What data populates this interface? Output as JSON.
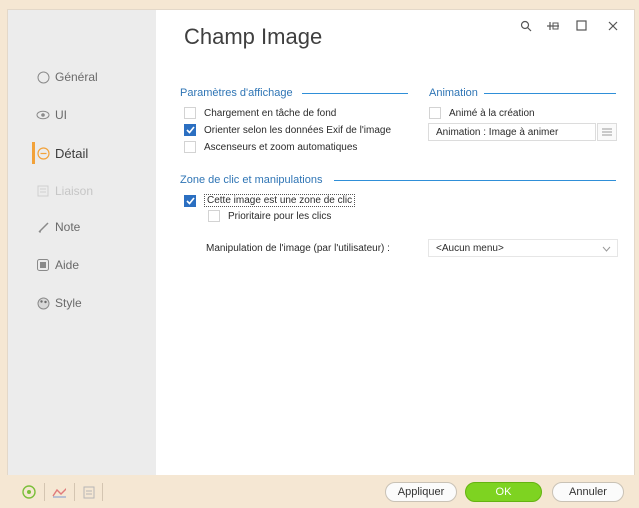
{
  "window": {
    "title": "Champ Image",
    "controls": {
      "search": "⌕",
      "pin": "⊣",
      "maximize": "☐",
      "close": "×"
    }
  },
  "sidebar": {
    "items": [
      {
        "label": "Général",
        "icon": "circle-icon",
        "state": "normal"
      },
      {
        "label": "UI",
        "icon": "eye-icon",
        "state": "normal"
      },
      {
        "label": "Détail",
        "icon": "detail-icon",
        "state": "active"
      },
      {
        "label": "Liaison",
        "icon": "link-icon",
        "state": "disabled"
      },
      {
        "label": "Note",
        "icon": "pencil-icon",
        "state": "normal"
      },
      {
        "label": "Aide",
        "icon": "help-icon",
        "state": "normal"
      },
      {
        "label": "Style",
        "icon": "palette-icon",
        "state": "normal"
      }
    ]
  },
  "display_params": {
    "title": "Paramètres d'affichage",
    "options": [
      {
        "label": "Chargement en tâche de fond",
        "checked": false
      },
      {
        "label": "Orienter selon les données Exif de l'image",
        "checked": true
      },
      {
        "label": "Ascenseurs et zoom automatiques",
        "checked": false
      }
    ]
  },
  "animation": {
    "title": "Animation",
    "option": {
      "label": "Animé à la création",
      "checked": false
    },
    "combo_value": "Animation : Image à animer"
  },
  "click_zone": {
    "title": "Zone de clic et manipulations",
    "options": [
      {
        "label": "Cette image est une zone de clic",
        "checked": true
      },
      {
        "label": "Prioritaire pour les clics",
        "checked": false
      }
    ],
    "manipulation_label": "Manipulation de l'image (par l'utilisateur) :",
    "manipulation_value": "<Aucun menu>"
  },
  "footer": {
    "apply": "Appliquer",
    "ok": "OK",
    "cancel": "Annuler"
  },
  "colors": {
    "accent": "#2f75b5",
    "ok_button": "#7ed321",
    "active_marker": "#f2a23a",
    "background": "#f5e7d3"
  }
}
